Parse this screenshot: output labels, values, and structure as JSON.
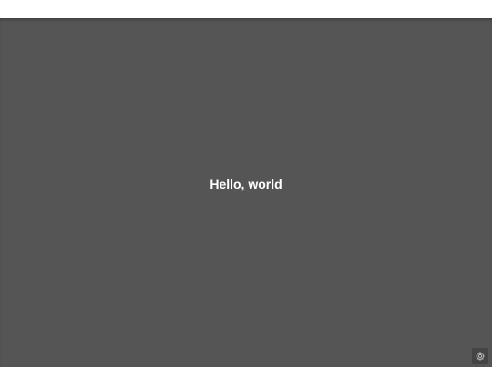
{
  "canvas": {
    "message": "Hello, world"
  },
  "controls": {
    "settings_icon": "gear-icon"
  },
  "colors": {
    "canvas_bg": "#555555",
    "text": "#ffffff",
    "button_bg": "#444444"
  }
}
